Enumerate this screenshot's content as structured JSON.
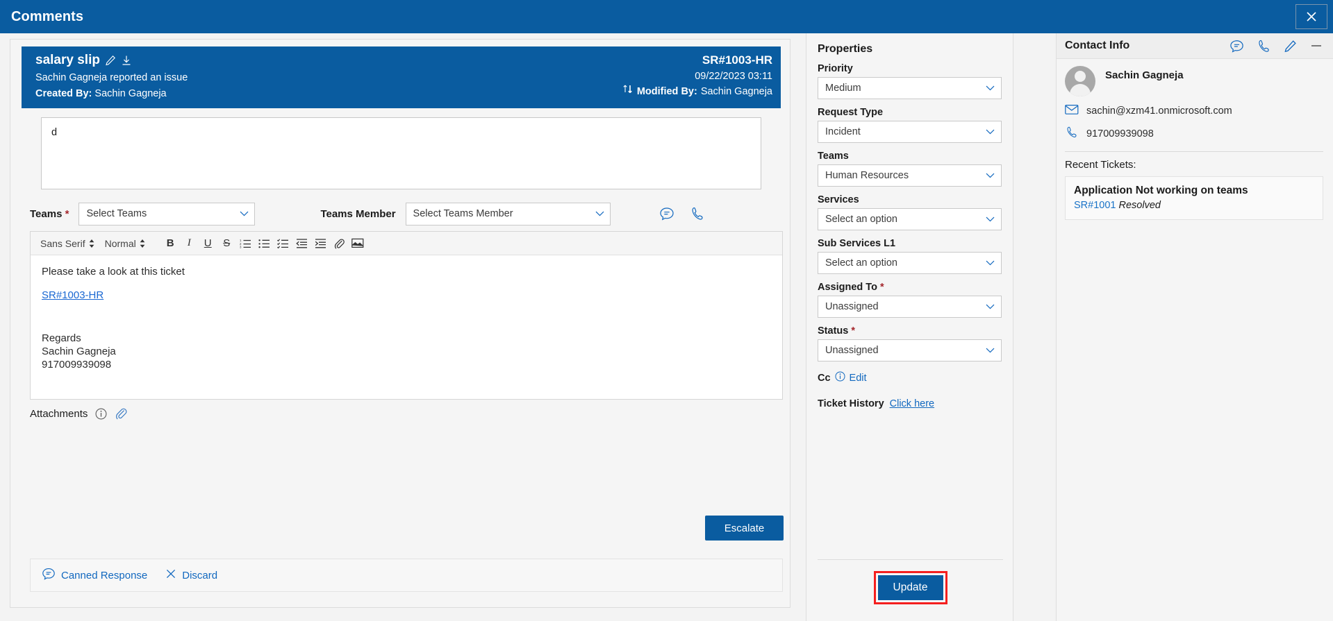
{
  "header": {
    "title": "Comments",
    "close_icon": "close-icon"
  },
  "ticket_card": {
    "title": "salary slip",
    "edit_icon": "pencil-icon",
    "download_icon": "download-icon",
    "subtitle": "Sachin Gagneja reported an issue",
    "created_by_label": "Created By:",
    "created_by_value": "Sachin Gagneja",
    "ticket_id": "SR#1003-HR",
    "date": "09/22/2023 03:11",
    "sort_icon": "sort-arrows-icon",
    "modified_by_label": "Modified By:",
    "modified_by_value": "Sachin Gagneja"
  },
  "comment_input": {
    "value": "d",
    "placeholder": ""
  },
  "teams_row": {
    "teams_label": "Teams",
    "teams_required": "*",
    "teams_value": "Select Teams",
    "member_label": "Teams Member",
    "member_value": "Select Teams Member",
    "chat_icon": "chat-bubble-icon",
    "call_icon": "phone-icon"
  },
  "editor": {
    "font_family": "Sans Serif",
    "font_size": "Normal",
    "buttons": [
      {
        "name": "bold-button",
        "glyph": "B"
      },
      {
        "name": "italic-button",
        "glyph": "I"
      },
      {
        "name": "underline-button",
        "glyph": "U"
      },
      {
        "name": "strikethrough-button",
        "glyph": "S"
      },
      {
        "name": "ordered-list-button",
        "glyph": "1."
      },
      {
        "name": "bullet-list-button",
        "glyph": "•"
      },
      {
        "name": "checklist-button",
        "glyph": "✓"
      },
      {
        "name": "outdent-button",
        "glyph": "←"
      },
      {
        "name": "indent-button",
        "glyph": "→"
      },
      {
        "name": "attach-link-button",
        "glyph": "link"
      },
      {
        "name": "insert-image-button",
        "glyph": "image"
      }
    ],
    "line1": "Please take a look at this ticket",
    "link": "SR#1003-HR",
    "sig1": "Regards",
    "sig2": "Sachin Gagneja",
    "sig3": "917009939098"
  },
  "attachments": {
    "label": "Attachments",
    "info_icon": "info-icon",
    "clip_icon": "paperclip-icon"
  },
  "escalate": {
    "label": "Escalate"
  },
  "footer": {
    "canned_response": "Canned Response",
    "canned_icon": "chat-bubble-icon",
    "discard": "Discard",
    "discard_icon": "close-icon"
  },
  "properties": {
    "title": "Properties",
    "fields": [
      {
        "label": "Priority",
        "required": "",
        "value": "Medium",
        "name": "priority"
      },
      {
        "label": "Request Type",
        "required": "",
        "value": "Incident",
        "name": "request-type"
      },
      {
        "label": "Teams",
        "required": "",
        "value": "Human Resources",
        "name": "teams"
      },
      {
        "label": "Services",
        "required": "",
        "value": "Select an option",
        "name": "services"
      },
      {
        "label": "Sub Services L1",
        "required": "",
        "value": "Select an option",
        "name": "sub-services-l1"
      },
      {
        "label": "Assigned To",
        "required": "*",
        "value": "Unassigned",
        "name": "assigned-to"
      },
      {
        "label": "Status",
        "required": "*",
        "value": "Unassigned",
        "name": "status"
      }
    ],
    "cc_label": "Cc",
    "cc_info_icon": "info-icon",
    "cc_edit": "Edit",
    "history_label": "Ticket History",
    "history_link": "Click here",
    "update_label": "Update",
    "highlight_color": "#f41f1f"
  },
  "contact": {
    "title": "Contact Info",
    "icons": [
      "chat-bubble-icon",
      "phone-icon",
      "pencil-icon",
      "minimize-icon"
    ],
    "avatar": "avatar",
    "name": "Sachin Gagneja",
    "email_icon": "mail-icon",
    "email": "sachin@xzm41.onmicrosoft.com",
    "phone_icon": "phone-icon",
    "phone": "917009939098",
    "recent_label": "Recent Tickets:",
    "recent_tickets": [
      {
        "title": "Application Not working on teams",
        "id": "SR#1001",
        "status": "Resolved"
      }
    ]
  },
  "colors": {
    "brand_blue": "#0a5ca0",
    "link_blue": "#1168bf",
    "required_red": "#a4262c",
    "highlight_red": "#f41f1f"
  }
}
